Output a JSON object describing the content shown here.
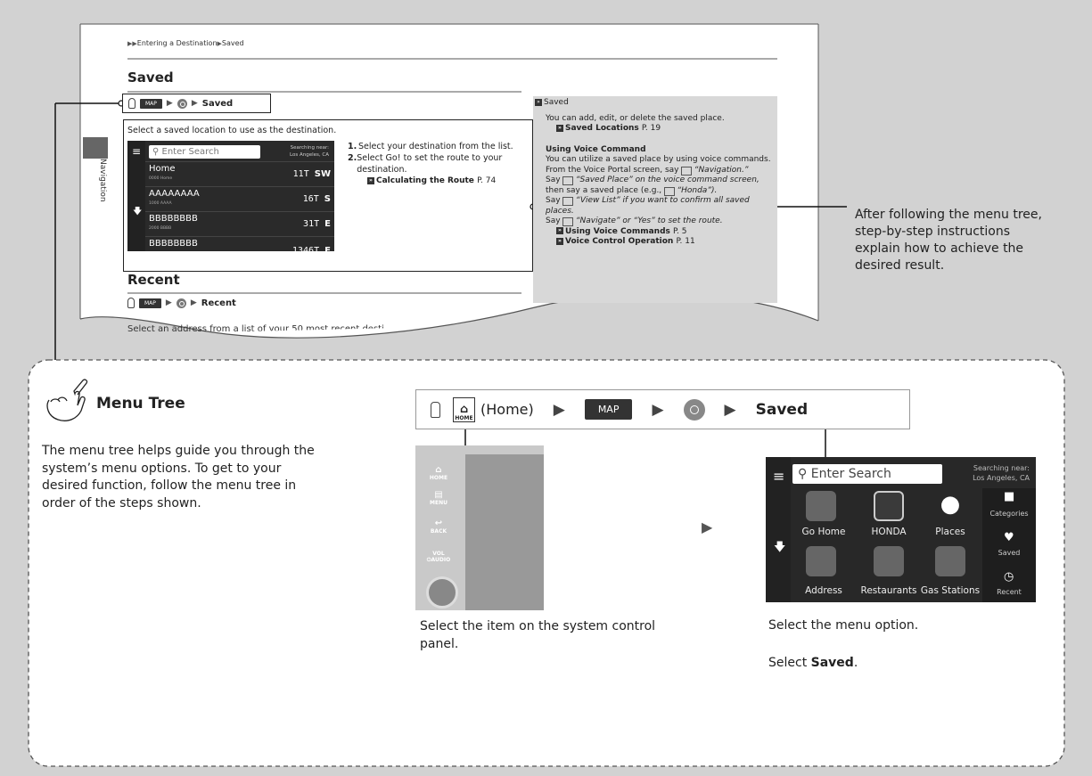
{
  "page": {
    "breadcrumb": [
      "Entering a Destination",
      "Saved"
    ],
    "section_title": "Saved",
    "side_tab_label": "Navigation",
    "menu_path": {
      "map_label": "MAP",
      "final": "Saved"
    },
    "intro": "Select a saved location to use as the destination.",
    "screen": {
      "search_placeholder": "Enter Search",
      "near_label": "Searching near:",
      "near_value": "Los Angeles, CA",
      "rows": [
        {
          "name": "Home",
          "sub": "0000 Home",
          "dist": "11",
          "unit": "T",
          "dir": "SW"
        },
        {
          "name": "AAAAAAAA",
          "sub": "1000 AAAA",
          "dist": "16",
          "unit": "T",
          "dir": "S"
        },
        {
          "name": "BBBBBBBB",
          "sub": "2000 BBBB",
          "dist": "31",
          "unit": "T",
          "dir": "E"
        },
        {
          "name": "BBBBBBBB",
          "sub": "",
          "dist": "1346",
          "unit": "T",
          "dir": "E"
        }
      ]
    },
    "steps": [
      {
        "num": "1.",
        "text": "Select your destination from the list."
      },
      {
        "num": "2.",
        "text": "Select Go! to set the route to your destination."
      }
    ],
    "step_ref": {
      "title": "Calculating the Route",
      "page": "P. 74"
    },
    "side_note": {
      "head": "Saved",
      "p1": "You can add, edit, or delete the saved place.",
      "ref1": {
        "title": "Saved Locations",
        "page": "P. 19"
      },
      "subhead": "Using Voice Command",
      "p2": "You can utilize a saved place by using voice commands.",
      "p3": "From the Voice Portal screen, say",
      "p3_cmd": "“Navigation.”",
      "p4": "Say",
      "p4_cmd": "“Saved Place” on the voice command screen,",
      "p5": "then say a saved place (e.g.,",
      "p5_cmd": "“Honda”).",
      "p6_cmd": "“View List” if you want to confirm all saved places.",
      "p7_cmd": "“Navigate” or “Yes” to set the route.",
      "ref2": {
        "title": "Using Voice Commands",
        "page": "P. 5"
      },
      "ref3": {
        "title": "Voice Control Operation",
        "page": "P. 11"
      }
    },
    "recent_title": "Recent",
    "recent_menu_final": "Recent",
    "recent_text": "Select an address from a list of your 50 most recent desti"
  },
  "callout": "After following the menu tree, step-by-step instructions explain how to achieve the desired result.",
  "menu_tree": {
    "title": "Menu Tree",
    "body": "The menu tree helps guide you through the system’s menu options. To get to your desired function, follow the menu tree in order of the steps shown.",
    "bar": {
      "home_label": "(Home)",
      "home_icon_text": "HOME",
      "map_label": "MAP",
      "saved_label": "Saved"
    },
    "panel_labels": [
      "HOME",
      "MENU",
      "BACK",
      "VOL\n⏻AUDIO"
    ],
    "menu_screen": {
      "search": "Enter Search",
      "near_label": "Searching near:",
      "near_value": "Los Angeles, CA",
      "items": [
        "Go Home",
        "HONDA",
        "Places",
        "Address",
        "Restaurants",
        "Gas Stations"
      ],
      "right_items": [
        "Categories",
        "Saved",
        "Recent"
      ]
    },
    "caption_left": "Select the item on the system control panel.",
    "caption_right1": "Select the menu option.",
    "caption_right2_prefix": "Select ",
    "caption_right2_bold": "Saved",
    "caption_right2_suffix": "."
  }
}
